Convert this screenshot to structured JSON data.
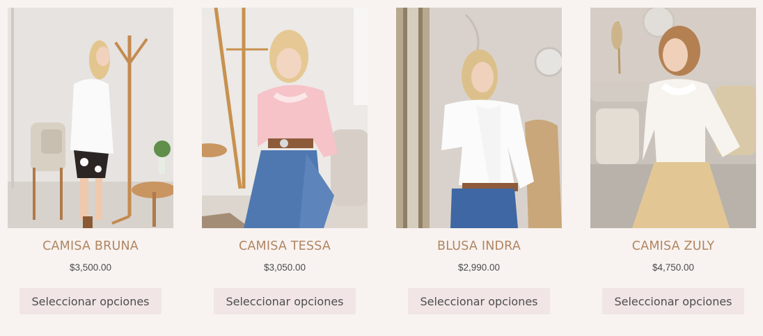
{
  "products": [
    {
      "name": "CAMISA BRUNA",
      "price": "$3,500.00",
      "button_label": "Seleccionar opciones",
      "image_alt": "Camisa Bruna"
    },
    {
      "name": "CAMISA TESSA",
      "price": "$3,050.00",
      "button_label": "Seleccionar opciones",
      "image_alt": "Camisa Tessa"
    },
    {
      "name": "BLUSA INDRA",
      "price": "$2,990.00",
      "button_label": "Seleccionar opciones",
      "image_alt": "Blusa Indra"
    },
    {
      "name": "CAMISA ZULY",
      "price": "$4,750.00",
      "button_label": "Seleccionar opciones",
      "image_alt": "Camisa Zuly"
    }
  ],
  "colors": {
    "background": "#f8f3f1",
    "title": "#b08560",
    "button_bg": "#f1e5e5",
    "button_text": "#4d4d4d"
  }
}
